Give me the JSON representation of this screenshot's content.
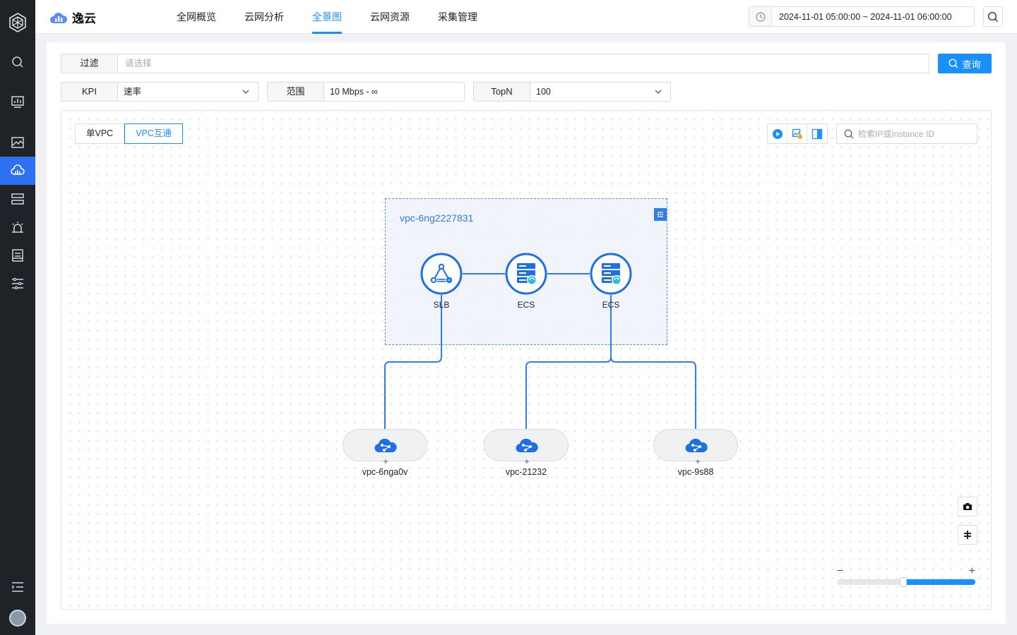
{
  "app": {
    "name": "逸云"
  },
  "nav": {
    "items": [
      {
        "label": "全网概览"
      },
      {
        "label": "云网分析"
      },
      {
        "label": "全景图"
      },
      {
        "label": "云网资源"
      },
      {
        "label": "采集管理"
      }
    ],
    "active": "全景图"
  },
  "header": {
    "time_range": "2024-11-01 05:00:00  ~  2024-11-01 06:00:00"
  },
  "filter": {
    "label": "过滤",
    "placeholder": "请选择",
    "query_label": "查询"
  },
  "options": {
    "kpi_label": "KPI",
    "kpi_value": "速率",
    "range_label": "范围",
    "range_value": "10 Mbps - ∞",
    "topn_label": "TopN",
    "topn_value": "100"
  },
  "canvas": {
    "tabs": [
      {
        "label": "单VPC"
      },
      {
        "label": "VPC互通"
      }
    ],
    "active_tab": "VPC互通",
    "search_placeholder": "检索IP或Instance ID"
  },
  "topology": {
    "vpc_title": "vpc-6ng2227831",
    "nodes": [
      {
        "label": "SLB",
        "icon": "load-balancer-icon"
      },
      {
        "label": "ECS",
        "icon": "server-icon"
      },
      {
        "label": "ECS",
        "icon": "server-icon"
      }
    ],
    "remote_vpcs": [
      {
        "label": "vpc-6nga0v"
      },
      {
        "label": "vpc-21232"
      },
      {
        "label": "vpc-9s88"
      }
    ]
  },
  "zoom": {
    "level": 0.48,
    "minus": "−",
    "plus": "+"
  },
  "colors": {
    "accent": "#1890ff",
    "sidebar_bg": "#1f2227",
    "sidebar_active": "#2f6ff1",
    "node_blue": "#1e6ee8"
  }
}
